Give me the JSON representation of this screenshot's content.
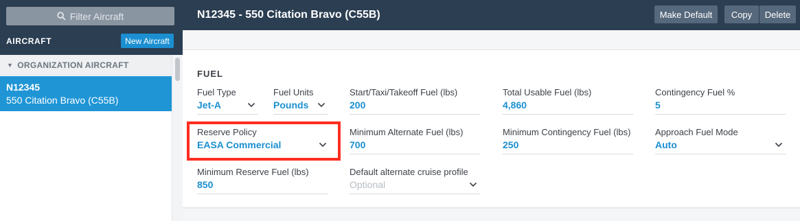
{
  "sidebar": {
    "filter_placeholder": "Filter Aircraft",
    "heading": "AIRCRAFT",
    "new_button": "New Aircraft",
    "group_label": "ORGANIZATION AIRCRAFT",
    "items": [
      {
        "registration": "N12345",
        "model": "550 Citation Bravo (C55B)"
      }
    ]
  },
  "header": {
    "title": "N12345 - 550 Citation Bravo (C55B)",
    "make_default": "Make Default",
    "copy": "Copy",
    "delete": "Delete"
  },
  "fuel": {
    "section_title": "FUEL",
    "fuel_type": {
      "label": "Fuel Type",
      "value": "Jet-A"
    },
    "fuel_units": {
      "label": "Fuel Units",
      "value": "Pounds"
    },
    "start_taxi_takeoff": {
      "label": "Start/Taxi/Takeoff Fuel (lbs)",
      "value": "200"
    },
    "total_usable": {
      "label": "Total Usable Fuel (lbs)",
      "value": "4,860"
    },
    "contingency_pct": {
      "label": "Contingency Fuel %",
      "value": "5"
    },
    "reserve_policy": {
      "label": "Reserve Policy",
      "value": "EASA Commercial"
    },
    "min_alternate": {
      "label": "Minimum Alternate Fuel (lbs)",
      "value": "700"
    },
    "min_contingency": {
      "label": "Minimum Contingency Fuel (lbs)",
      "value": "250"
    },
    "approach_mode": {
      "label": "Approach Fuel Mode",
      "value": "Auto"
    },
    "min_reserve": {
      "label": "Minimum Reserve Fuel (lbs)",
      "value": "850"
    },
    "alt_cruise_profile": {
      "label": "Default alternate cruise profile",
      "placeholder": "Optional"
    }
  },
  "colors": {
    "accent": "#1b8fd1",
    "header_bg": "#2b3e52",
    "highlight": "#ff2d1f"
  }
}
